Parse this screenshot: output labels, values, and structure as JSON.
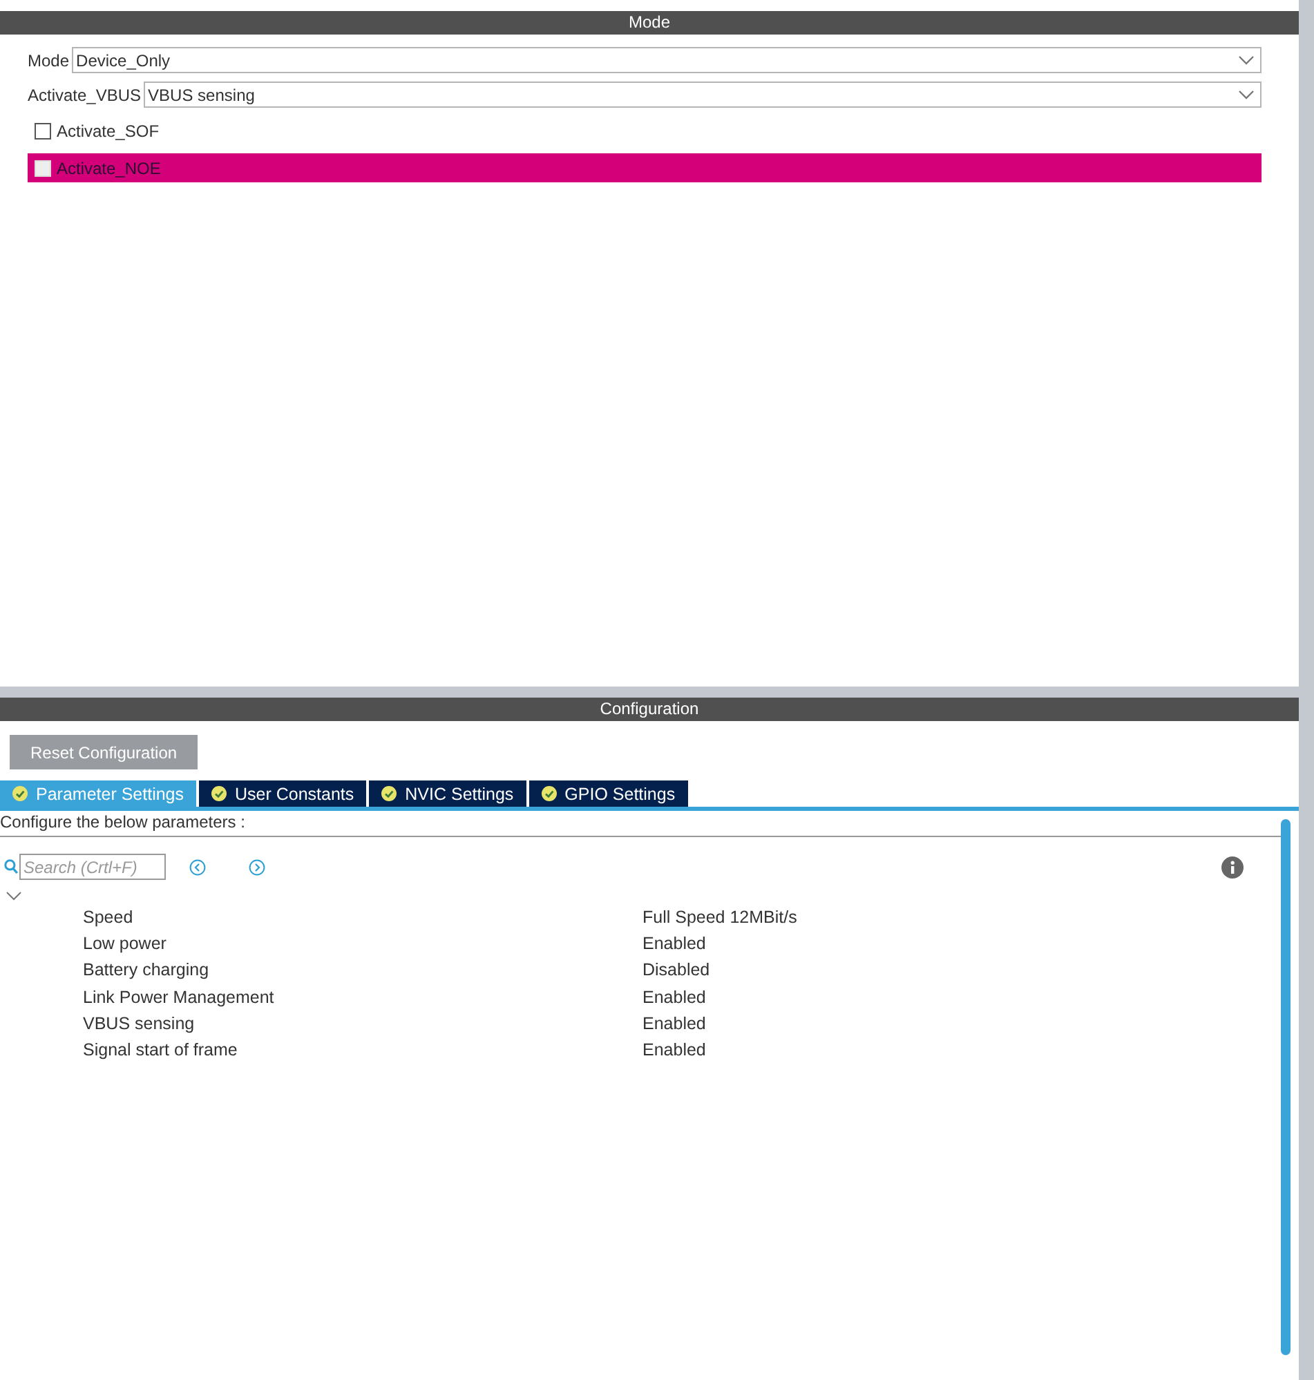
{
  "mode_panel": {
    "title": "Mode",
    "fields": [
      {
        "label": "Mode",
        "value": "Device_Only"
      },
      {
        "label": "Activate_VBUS",
        "value": "VBUS sensing"
      }
    ],
    "checkboxes": [
      {
        "label": "Activate_SOF",
        "checked": false,
        "highlighted": false
      },
      {
        "label": "Activate_NOE",
        "checked": false,
        "highlighted": true
      }
    ]
  },
  "config_panel": {
    "title": "Configuration",
    "reset_button": "Reset Configuration",
    "tabs": [
      {
        "label": "Parameter Settings",
        "selected": true
      },
      {
        "label": "User Constants",
        "selected": false
      },
      {
        "label": "NVIC Settings",
        "selected": false
      },
      {
        "label": "GPIO Settings",
        "selected": false
      }
    ],
    "hint": "Configure the below parameters :",
    "search": {
      "placeholder": "Search (Crtl+F)"
    },
    "group": {
      "expanded": true,
      "parameters": [
        {
          "name": "Speed",
          "value": "Full Speed 12MBit/s"
        },
        {
          "name": "Low power",
          "value": "Enabled"
        },
        {
          "name": "Battery charging",
          "value": "Disabled"
        },
        {
          "name": "Link Power Management",
          "value": "Enabled"
        },
        {
          "name": "VBUS sensing",
          "value": "Enabled"
        },
        {
          "name": "Signal start of frame",
          "value": "Enabled"
        }
      ]
    }
  }
}
